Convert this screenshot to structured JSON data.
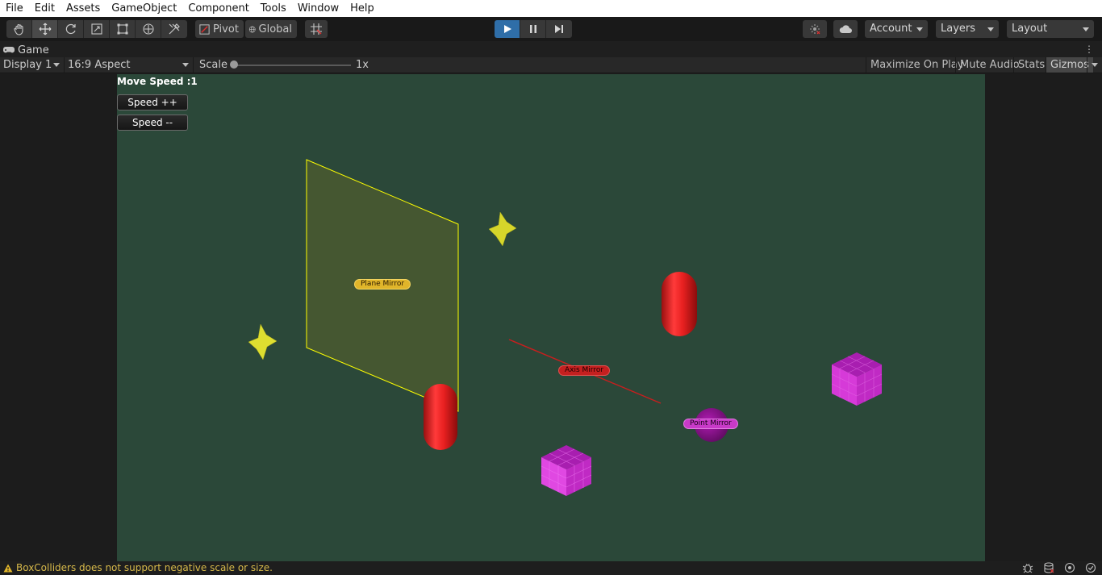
{
  "menubar": {
    "items": [
      "File",
      "Edit",
      "Assets",
      "GameObject",
      "Component",
      "Tools",
      "Window",
      "Help"
    ]
  },
  "toolbar": {
    "tools": [
      "hand-tool-icon",
      "move-tool-icon",
      "rotate-tool-icon",
      "scale-tool-icon",
      "rect-tool-icon",
      "transform-tool-icon",
      "custom-tool-icon"
    ],
    "pivot_label": "Pivot",
    "global_label": "Global",
    "account_label": "Account",
    "layers_label": "Layers",
    "layout_label": "Layout"
  },
  "tab": {
    "title": "Game"
  },
  "gamebar": {
    "display": "Display 1",
    "aspect": "16:9 Aspect",
    "scale_label": "Scale",
    "scale_value": "1x",
    "maximize": "Maximize On Play",
    "mute": "Mute Audio",
    "stats": "Stats",
    "gizmos": "Gizmos"
  },
  "game": {
    "move_speed": "Move Speed :1",
    "speed_up": "Speed ++",
    "speed_down": "Speed --",
    "labels": {
      "plane": "Plane Mirror",
      "axis": "Axis Mirror",
      "point": "Point Mirror"
    }
  },
  "status": {
    "message": "BoxColliders does not support negative scale or size."
  },
  "colors": {
    "viewport_bg": "#2b4839",
    "play_active": "#2f6ea8",
    "star": "#e0e02a",
    "capsule": "#e02828",
    "cube": "#d63ad8",
    "plane_edge": "#ffff00",
    "axis_line": "#c81e1e"
  }
}
